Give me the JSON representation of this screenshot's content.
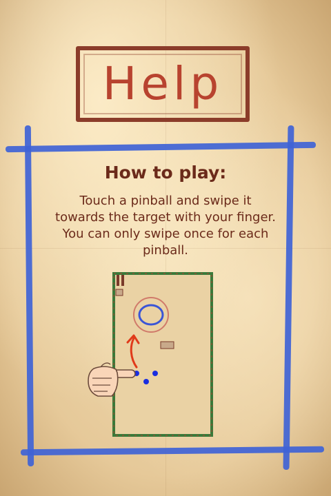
{
  "screen": {
    "title": "Help",
    "heading": "How to play:",
    "instructions": "Touch a pinball and swipe it towards the target with your finger. You can only swipe once for each pinball."
  },
  "colors": {
    "title": "#b8432f",
    "text": "#6b2a1a",
    "frame_lines": "#3f63d6",
    "table_border": "#3a7a3a",
    "arrow": "#e03a1a",
    "pinball": "#1a2ee0",
    "target": "#3a55d6"
  },
  "icons": {
    "pointing_hand": "pointing-hand-icon",
    "swipe_arrow": "arrow-up-icon"
  },
  "example_table": {
    "pinballs_shown": 3
  }
}
